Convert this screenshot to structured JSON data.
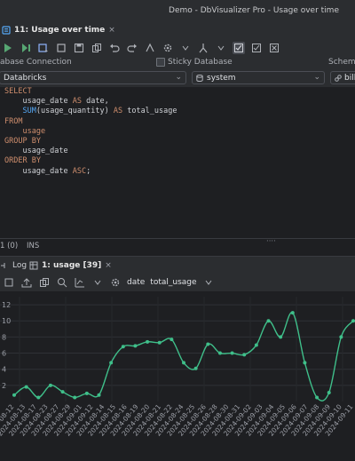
{
  "window": {
    "title": "Demo - DbVisualizer Pro - Usage over time"
  },
  "editor_tab": {
    "label": "11: Usage over time",
    "close": "×"
  },
  "connection": {
    "connection_label": "abase Connection",
    "sticky_label": "Sticky Database",
    "schema_label": "Schema",
    "connection_value": "Databricks",
    "database_value": "system",
    "schema_value": "billi"
  },
  "sql": {
    "lines": [
      [
        {
          "t": "SELECT",
          "c": "kw"
        }
      ],
      [
        {
          "t": "    usage_date ",
          "c": ""
        },
        {
          "t": "AS",
          "c": "kw"
        },
        {
          "t": " date,",
          "c": ""
        }
      ],
      [
        {
          "t": "    ",
          "c": ""
        },
        {
          "t": "SUM",
          "c": "fn"
        },
        {
          "t": "(usage_quantity) ",
          "c": ""
        },
        {
          "t": "AS",
          "c": "kw"
        },
        {
          "t": " total_usage",
          "c": ""
        }
      ],
      [
        {
          "t": "FROM",
          "c": "kw"
        }
      ],
      [
        {
          "t": "    usage",
          "c": "kw"
        }
      ],
      [
        {
          "t": "GROUP BY",
          "c": "kw"
        }
      ],
      [
        {
          "t": "    usage_date",
          "c": ""
        }
      ],
      [
        {
          "t": "ORDER BY",
          "c": "kw"
        }
      ],
      [
        {
          "t": "    usage_date ",
          "c": ""
        },
        {
          "t": "ASC",
          "c": "kw"
        },
        {
          "t": ";",
          "c": ""
        }
      ]
    ]
  },
  "status": {
    "position": "1  (0)",
    "mode": "INS"
  },
  "bottom_tabs": {
    "log": "Log",
    "result": "1: usage [39]",
    "close": "×"
  },
  "chart_toolbar": {
    "x_field": "date",
    "y_field": "total_usage"
  },
  "chart_data": {
    "type": "line",
    "categories": [
      "2024-09-12",
      "2024-09-13",
      "2024-09-14",
      "2024-09-15",
      "2024-09-16",
      "2024-09-17",
      "2024-09-18",
      "2024-09-19",
      "2024-09-20",
      "2024-09-21",
      "2024-09-22",
      "2024-09-23",
      "2024-09-24",
      "2024-09-25",
      "2024-09-26",
      "2024-09-27",
      "2024-09-28",
      "2024-09-29",
      "2024-09-30",
      "2024-10-01",
      "2024-10-02",
      "2024-10-03",
      "2024-10-04",
      "2024-10-05",
      "2024-10-06",
      "2024-10-07",
      "2024-10-08",
      "2024-10-09",
      "2024-10-10",
      "2024-10-11",
      "2024-10-12",
      "2024-10-13",
      "2024-10-14",
      "2024-10-15",
      "2024-10-16",
      "2024-10-17",
      "2024-10-18",
      "2024-10-19",
      "2024-10-20"
    ],
    "tick_labels": [
      "2024-08-12",
      "2024-08-13",
      "2024-08-17",
      "2024-08-23",
      "2024-08-27",
      "2024-08-29",
      "2024-09-01",
      "2024-09-12",
      "2024-08-14",
      "2024-08-15",
      "2024-08-16",
      "2024-08-19",
      "2024-08-20",
      "2024-08-21",
      "2024-08-22",
      "2024-08-24",
      "2024-08-25",
      "2024-08-26",
      "2024-08-28",
      "2024-08-30",
      "2024-08-31",
      "2024-09-02",
      "2024-09-03",
      "2024-09-04",
      "2024-09-05",
      "2024-09-06",
      "2024-09-07",
      "2024-09-08",
      "2024-09-09",
      "2024-09-10",
      "2024-09-11"
    ],
    "values": [
      0.8,
      1.8,
      0.5,
      2.0,
      1.2,
      0.5,
      1.0,
      0.8,
      4.8,
      6.8,
      6.9,
      7.4,
      7.3,
      7.7,
      4.8,
      4.1,
      7.1,
      6.0,
      6.0,
      5.8,
      7.0,
      10.0,
      8.0,
      11.0,
      4.8,
      0.5,
      1.1,
      8.0,
      10.0
    ],
    "y_ticks": [
      "12",
      "10",
      "8",
      "6",
      "4",
      "2"
    ],
    "ylim": [
      0,
      13
    ],
    "color": "#3fbf8a",
    "grid": true
  },
  "colors": {
    "accent": "#3574f0",
    "series": "#3fbf8a",
    "keyword": "#cf8e6d",
    "function": "#56a8f5"
  }
}
